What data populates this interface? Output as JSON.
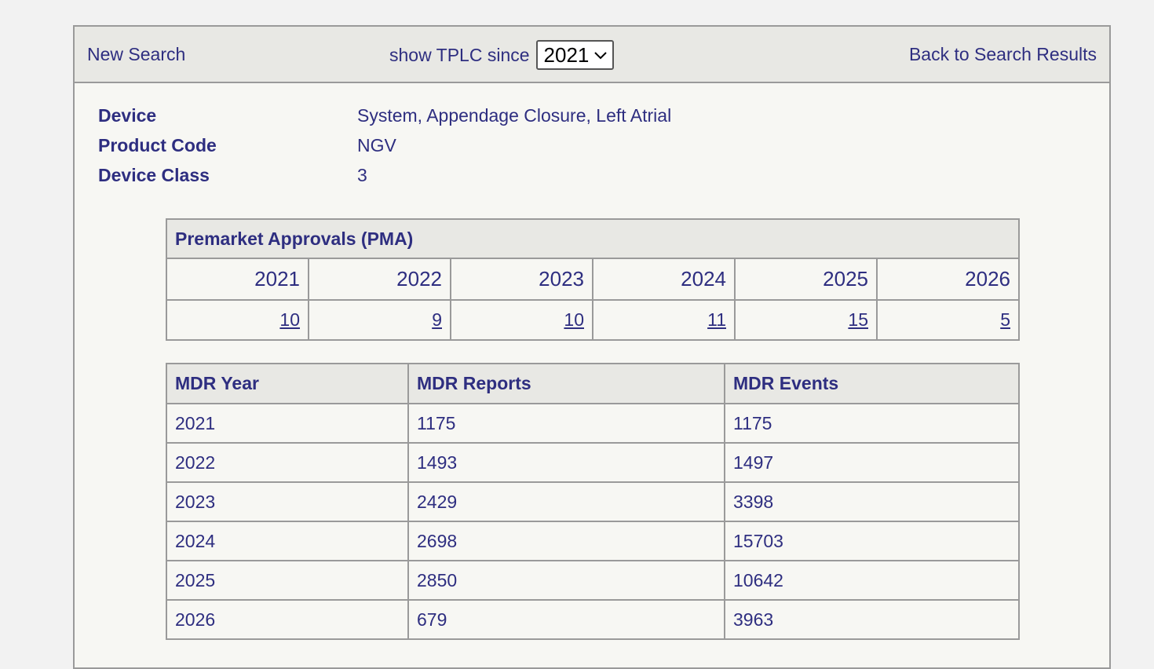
{
  "toolbar": {
    "new_search": "New Search",
    "tplc_label": "show TPLC since",
    "tplc_selected_year": "2021",
    "back_to_results": "Back to Search Results"
  },
  "device_info": [
    {
      "label": "Device",
      "value": "System, Appendage Closure, Left Atrial"
    },
    {
      "label": "Product Code",
      "value": "NGV"
    },
    {
      "label": "Device Class",
      "value": "3"
    }
  ],
  "pma": {
    "title": "Premarket Approvals (PMA)",
    "years": [
      "2021",
      "2022",
      "2023",
      "2024",
      "2025",
      "2026"
    ],
    "counts": [
      "10",
      "9",
      "10",
      "11",
      "15",
      "5"
    ]
  },
  "mdr": {
    "headers": [
      "MDR Year",
      "MDR Reports",
      "MDR Events"
    ],
    "rows": [
      [
        "2021",
        "1175",
        "1175"
      ],
      [
        "2022",
        "1493",
        "1497"
      ],
      [
        "2023",
        "2429",
        "3398"
      ],
      [
        "2024",
        "2698",
        "15703"
      ],
      [
        "2025",
        "2850",
        "10642"
      ],
      [
        "2026",
        "679",
        "3963"
      ]
    ]
  }
}
